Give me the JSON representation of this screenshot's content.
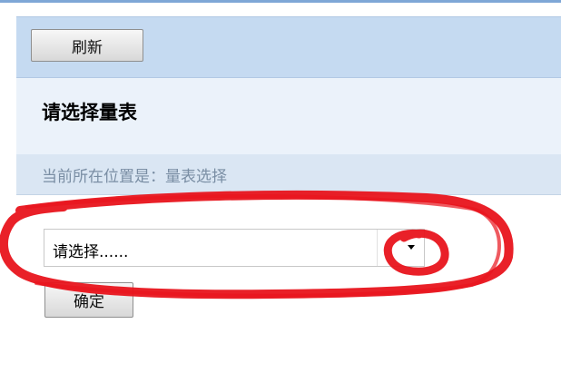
{
  "toolbar": {
    "refresh_label": "刷新"
  },
  "header": {
    "title": "请选择量表"
  },
  "location": {
    "text": "当前所在位置是：量表选择"
  },
  "form": {
    "select_value": "请选择......",
    "confirm_label": "确定"
  },
  "colors": {
    "annotation_red": "#e8141c",
    "toolbar_bg": "#c5daf1",
    "location_bg": "#dae6f3"
  }
}
